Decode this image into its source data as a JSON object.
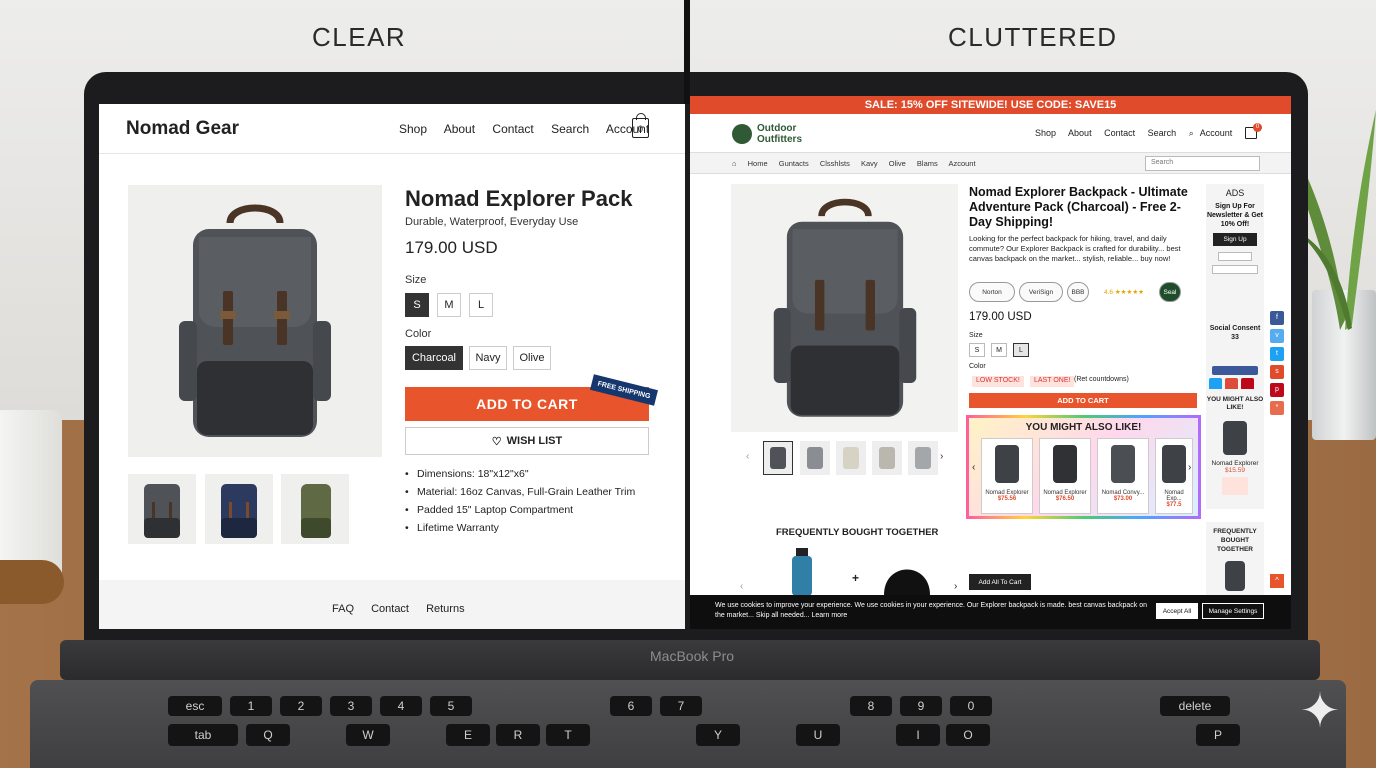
{
  "headings": {
    "left": "CLEAR",
    "right": "CLUTTERED"
  },
  "device_label": "MacBook Pro",
  "keys": {
    "row1": [
      "esc",
      "1",
      "2",
      "3",
      "4",
      "5",
      "6",
      "7",
      "8",
      "9",
      "0",
      "delete"
    ],
    "row2": [
      "tab",
      "Q",
      "W",
      "E",
      "R",
      "T",
      "Y",
      "U",
      "I",
      "O",
      "P"
    ]
  },
  "clear": {
    "logo": "Nomad Gear",
    "nav": [
      "Shop",
      "About",
      "Contact",
      "Search",
      "Account"
    ],
    "cart_count": "0",
    "product": {
      "title": "Nomad Explorer Pack",
      "subtitle": "Durable, Waterproof, Everyday Use",
      "price": "179.00 USD",
      "size_label": "Size",
      "sizes": [
        "S",
        "M",
        "L"
      ],
      "color_label": "Color",
      "colors": [
        "Charcoal",
        "Navy",
        "Olive"
      ],
      "add_to_cart": "ADD TO CART",
      "ribbon": "FREE SHIPPING",
      "wishlist": "WISH LIST",
      "bullets": [
        "Dimensions: 18\"x12\"x6\"",
        "Material: 16oz Canvas, Full-Grain Leather Trim",
        "Padded 15\" Laptop Compartment",
        "Lifetime Warranty"
      ]
    },
    "footer": [
      "FAQ",
      "Contact",
      "Returns"
    ],
    "colors_hex": {
      "accent": "#e8542b",
      "selected": "#333333"
    }
  },
  "cluttered": {
    "sale_banner": "SALE: 15% OFF SITEWIDE! USE CODE: SAVE15",
    "logo": "Outdoor Outfitters",
    "nav": [
      "Shop",
      "About",
      "Contact",
      "Search",
      "Account"
    ],
    "cart_count": "0",
    "subnav": [
      "Home",
      "Guntacts",
      "Clsshlsts",
      "Kavy",
      "Olive",
      "Blams",
      "Azcount"
    ],
    "search_placeholder": "Search",
    "product": {
      "title": "Nomad Explorer Backpack - Ultimate Adventure Pack (Charcoal) - Free 2-Day Shipping!",
      "description": "Looking for the perfect backpack for hiking, travel, and daily commute? Our Explorer Backpack is crafted for durability... best canvas backpack on the market... stylish, reliable... buy now!",
      "badges": [
        "Norton",
        "VeriSign",
        "BBB",
        "4.6 ★★★★★",
        "Seal"
      ],
      "price": "179.00 USD",
      "size_label": "Size",
      "sizes": [
        "S",
        "M",
        "L"
      ],
      "color_label": "Color",
      "warnings": [
        "LOW STOCK!",
        "LAST ONE!"
      ],
      "countdown": "(Ret countdowns)",
      "add_to_cart": "ADD TO CART"
    },
    "you_might_like": {
      "title": "YOU MIGHT ALSO LIKE!",
      "items": [
        {
          "name": "Nomad Explorer",
          "price": "$75.56"
        },
        {
          "name": "Nomad Explorer",
          "price": "$76.50"
        },
        {
          "name": "Nomad Convy...",
          "price": "$73.00"
        },
        {
          "name": "Nomad Exp...",
          "price": "$77.5"
        }
      ]
    },
    "fbt": {
      "title": "FREQUENTLY BOUGHT TOGETHER",
      "add_all": "Add All To Cart"
    },
    "sidebar": {
      "ads_title": "ADS",
      "ads_text": "Sign Up For Newsletter & Get 10% Off!",
      "ads_button": "Sign Up",
      "social_title": "Social Consent 33",
      "bought_title": "YOU MIGHT ALSO LIKE!",
      "bought_name": "Nomad Explorer",
      "bought_price": "$15.59",
      "freq_title": "FREQUENTLY BOUGHT TOGETHER"
    },
    "cookie": {
      "text": "We use cookies to improve your experience. We use cookies in your experience. Our Explorer backpack is made. best canvas backpack on the market... Skip all needed... Learn more",
      "accept": "Accept All",
      "manage": "Manage Settings"
    },
    "colors_hex": {
      "sale": "#e04b2b",
      "accent": "#e8542b"
    }
  }
}
